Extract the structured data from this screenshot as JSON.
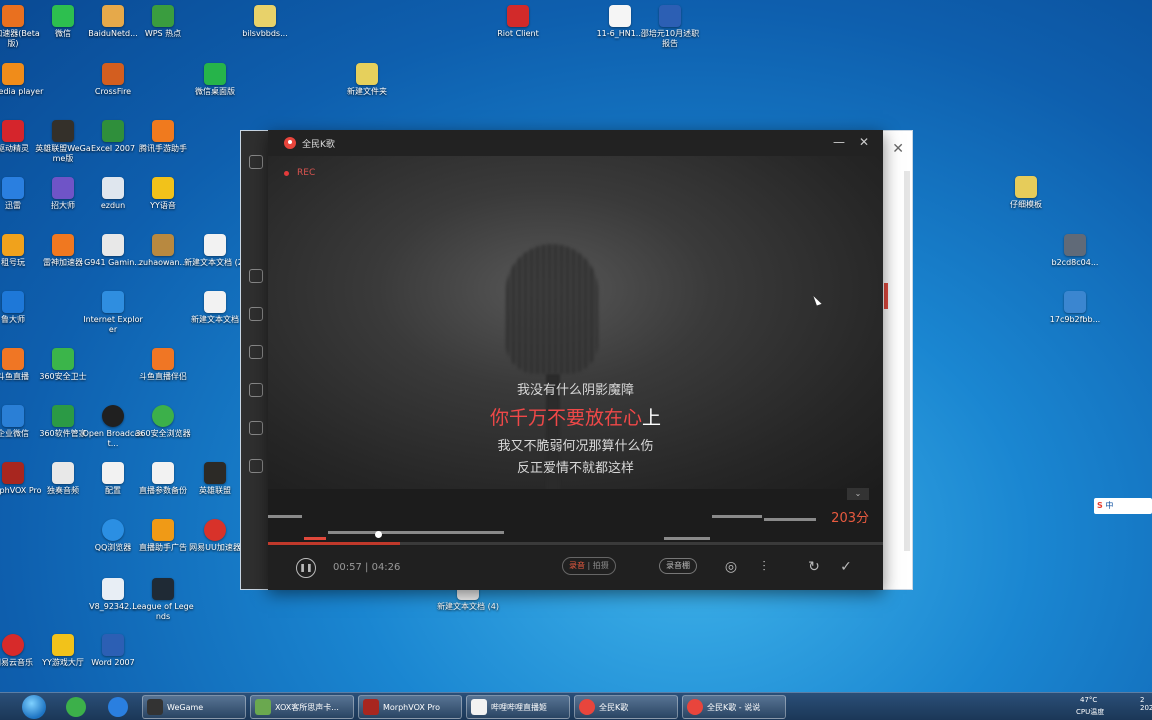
{
  "desktop": {
    "icons": [
      {
        "label": "神加速器(Beta版)"
      },
      {
        "label": "微信"
      },
      {
        "label": "BaiduNetd..."
      },
      {
        "label": "WPS 热点"
      },
      {
        "label": "bilsvbbds..."
      },
      {
        "label": "Riot Client"
      },
      {
        "label": "11-6_HN1..."
      },
      {
        "label": "邵培元10月述职报告"
      },
      {
        "label": "C media player"
      },
      {
        "label": "CrossFire"
      },
      {
        "label": "微信桌面版"
      },
      {
        "label": "新建文件夹"
      },
      {
        "label": "驱动精灵"
      },
      {
        "label": "英雄联盟WeGame版"
      },
      {
        "label": "Excel 2007"
      },
      {
        "label": "腾讯手游助手"
      },
      {
        "label": "迅雷"
      },
      {
        "label": "招大师"
      },
      {
        "label": "ezdun"
      },
      {
        "label": "YY语音"
      },
      {
        "label": "租号玩"
      },
      {
        "label": "雷神加速器"
      },
      {
        "label": "G941 Gamin..."
      },
      {
        "label": "zuhaowan..."
      },
      {
        "label": "新建文本文档 (2)"
      },
      {
        "label": "鲁大师"
      },
      {
        "label": "Internet Explorer"
      },
      {
        "label": "新建文本文档"
      },
      {
        "label": "斗鱼直播"
      },
      {
        "label": "360安全卫士"
      },
      {
        "label": "斗鱼直播伴侣"
      },
      {
        "label": "企业微信"
      },
      {
        "label": "360软件管家"
      },
      {
        "label": "Open Broadcast..."
      },
      {
        "label": "360安全浏览器"
      },
      {
        "label": "MorphVOX Pro"
      },
      {
        "label": "独奏音频"
      },
      {
        "label": "配置"
      },
      {
        "label": "直播参数备份"
      },
      {
        "label": "英雄联盟"
      },
      {
        "label": "QQ浏览器"
      },
      {
        "label": "直播助手广告"
      },
      {
        "label": "网易UU加速器"
      },
      {
        "label": "V8_92342..."
      },
      {
        "label": "League of Legends"
      },
      {
        "label": "新建文本文档 (4)"
      },
      {
        "label": "网易云音乐"
      },
      {
        "label": "YY游戏大厅"
      },
      {
        "label": "Word 2007"
      },
      {
        "label": "仔细模板"
      },
      {
        "label": "b2cd8c04..."
      },
      {
        "label": "17c9b2fbb..."
      }
    ]
  },
  "ktv": {
    "title": "全民K歌",
    "rec_label": "REC",
    "lyrics": {
      "prev": "我没有什么阴影魔障",
      "current_sung": "你千万不要放在心",
      "current_rest": "上",
      "next1": "我又不脆弱何况那算什么伤",
      "next2": "反正爱情不就都这样"
    },
    "score": "203分",
    "time_current": "00:57",
    "time_separator": "|",
    "time_total": "04:26",
    "progress": 0.214,
    "mode_active": "录音",
    "mode_sep": "|",
    "mode_inactive": "拍摄",
    "record_button": "录音棚"
  },
  "taskbar": {
    "tasks": [
      {
        "label": "WeGame"
      },
      {
        "label": "XOX客所思声卡..."
      },
      {
        "label": "MorphVOX Pro"
      },
      {
        "label": "哔哩哔哩直播姬"
      },
      {
        "label": "全民K歌"
      },
      {
        "label": "全民K歌 - 说说"
      }
    ],
    "tray_temp": "47°C",
    "tray_cpu": "CPU温度",
    "clock_top": "2",
    "clock_bottom": "202"
  },
  "ime": {
    "label": "中"
  }
}
